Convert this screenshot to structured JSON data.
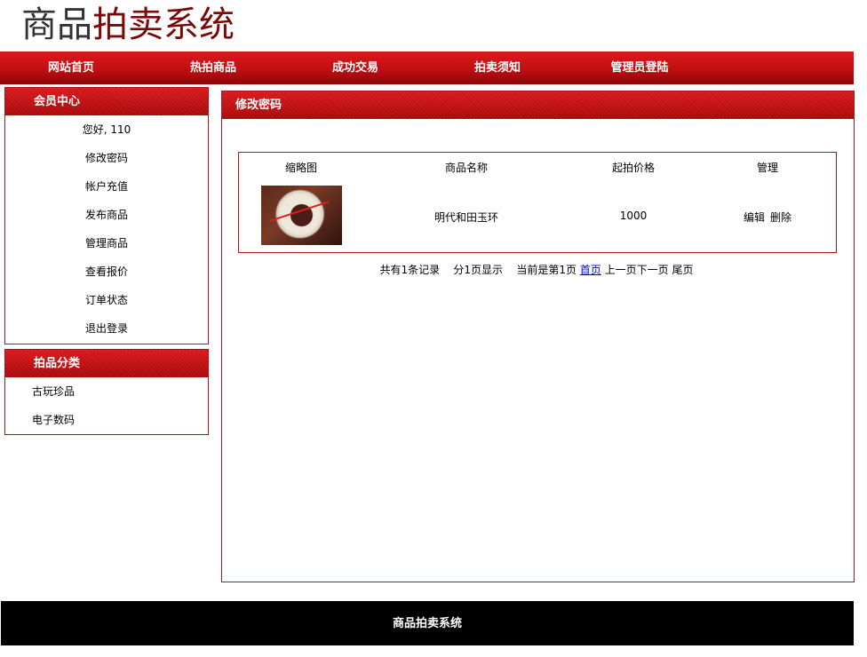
{
  "logo": {
    "part1": "商品",
    "part2": "拍卖系统"
  },
  "nav": [
    "网站首页",
    "热拍商品",
    "成功交易",
    "拍卖须知",
    "管理员登陆"
  ],
  "member_center": {
    "title": "会员中心",
    "items": [
      "您好, 110",
      "修改密码",
      "帐户充值",
      "发布商品",
      "管理商品",
      "查看报价",
      "订单状态",
      "退出登录"
    ]
  },
  "category": {
    "title": "拍品分类",
    "items": [
      "古玩珍品",
      "电子数码"
    ]
  },
  "main": {
    "title": "修改密码",
    "columns": [
      "缩略图",
      "商品名称",
      "起拍价格",
      "管理"
    ],
    "rows": [
      {
        "name": "明代和田玉环",
        "price": "1000",
        "edit": "编辑",
        "delete": "删除"
      }
    ],
    "pager": {
      "total": "共有1条记录",
      "pages": "分1页显示",
      "current": "当前是第1页",
      "first": "首页",
      "prev": "上一页",
      "next": "下一页",
      "last": "尾页"
    }
  },
  "footer": "商品拍卖系统"
}
